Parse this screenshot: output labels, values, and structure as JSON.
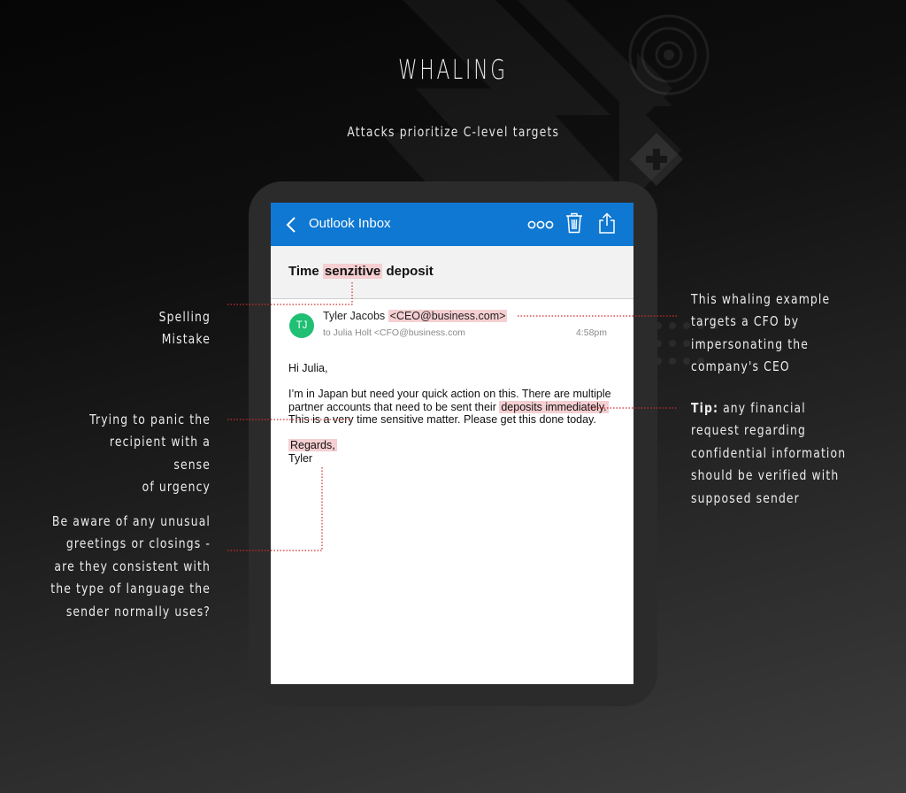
{
  "title": "WHALING",
  "subtitle": "Attacks prioritize C-level targets",
  "annotations": {
    "spelling": "Spelling\nMistake",
    "urgency": "Trying to panic the\nrecipient with a sense\nof urgency",
    "greetings": "Be aware of any unusual\ngreetings or closings -\nare they consistent with\nthe type of language the\nsender normally uses?",
    "impersonation": "This whaling example\ntargets a CFO by\nimpersonating the\ncompany's CEO",
    "tip_label": "Tip:",
    "tip_text": " any financial\nrequest regarding\nconfidential information\nshould be verified with\nsupposed sender"
  },
  "email": {
    "inbox_label": "Outlook Inbox",
    "subject_prefix": "Time ",
    "subject_highlight": "senzitive",
    "subject_suffix": " deposit",
    "avatar_initials": "TJ",
    "sender_name": "Tyler Jacobs ",
    "sender_address": "<CEO@business.com>",
    "to_line": "to Julia Holt <CFO@business.com",
    "time": "4:58pm",
    "greeting": "Hi Julia,",
    "body_before": "I’m in Japan but need your quick action on this. There are multiple partner accounts that need to be sent their ",
    "body_highlight": "deposits immediately.",
    "body_after": " This is a very time sensitive matter. Please get this done today.",
    "closing": "Regards,",
    "signature": "Tyler"
  },
  "icons": [
    "chevron-left-icon",
    "more-icon",
    "trash-icon",
    "share-icon"
  ],
  "colors": {
    "header_blue": "#0f78d2",
    "highlight_pink": "#f5cfd1",
    "callout_red": "#d22b2b",
    "avatar_green": "#1fbf74"
  }
}
